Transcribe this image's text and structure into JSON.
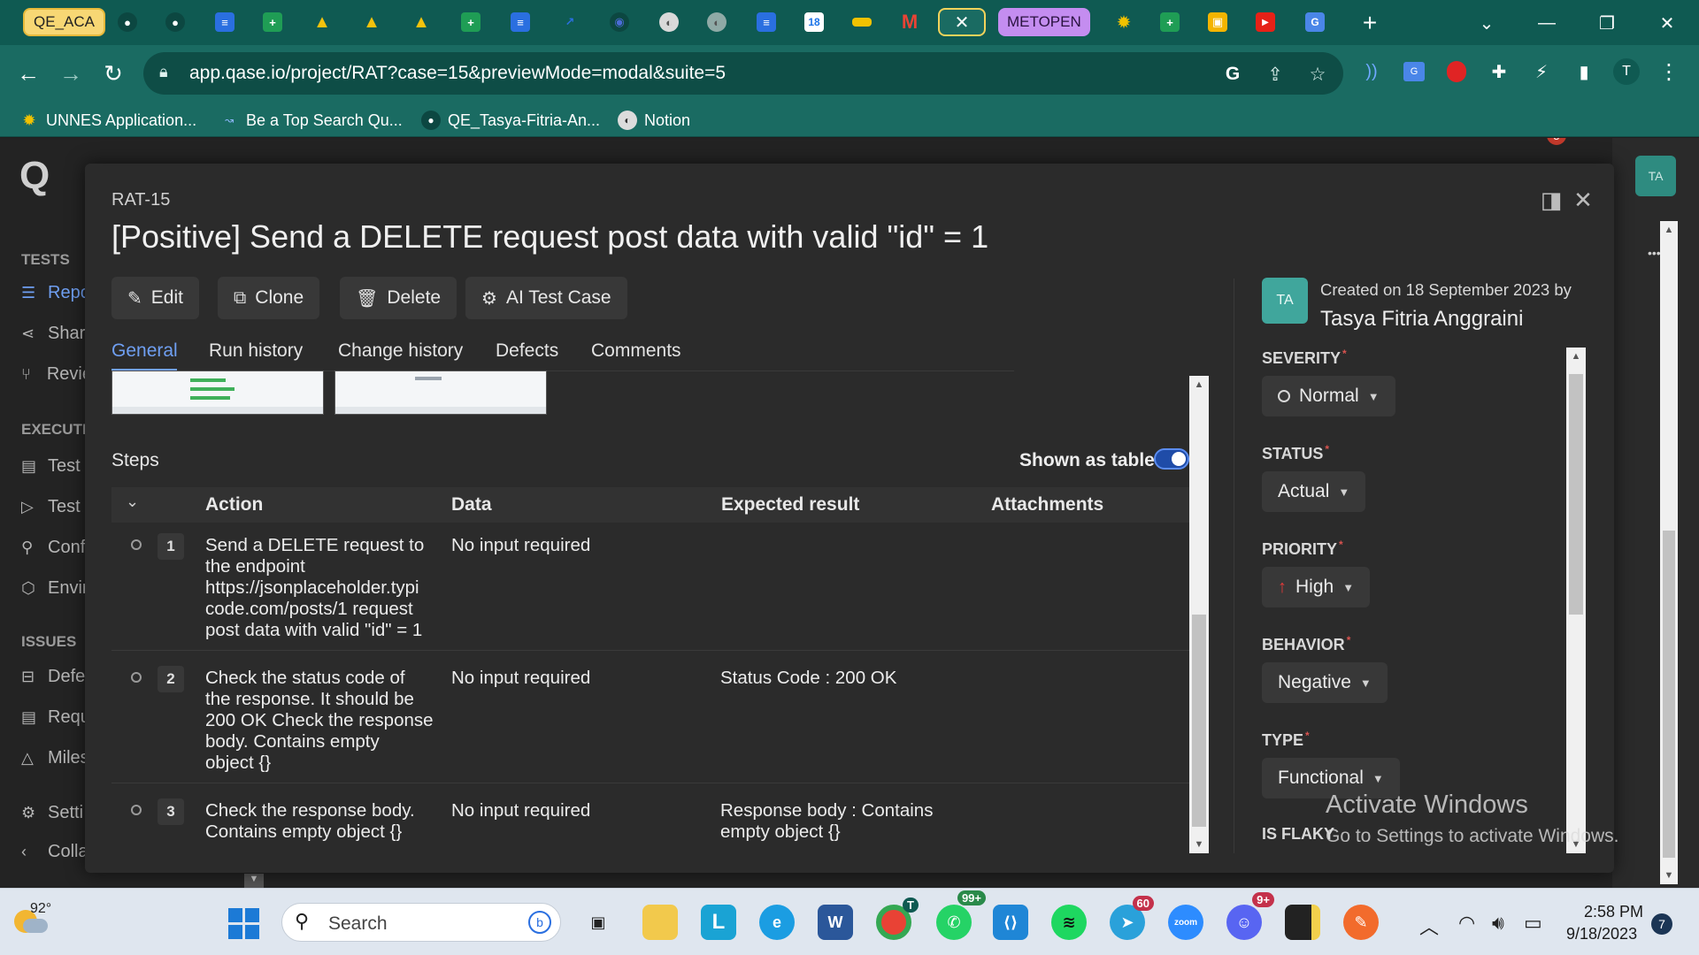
{
  "browser": {
    "tab_first_label": "QE_ACA",
    "tab_metopen_label": "METOPEN",
    "calendar_day": "18",
    "url": "app.qase.io/project/RAT?case=15&previewMode=modal&suite=5",
    "profile_initial": "T",
    "bookmarks": [
      {
        "label": "UNNES Application..."
      },
      {
        "label": "Be a Top Search Qu..."
      },
      {
        "label": "QE_Tasya-Fitria-An..."
      },
      {
        "label": "Notion"
      }
    ]
  },
  "app": {
    "logo": "Q",
    "notification_count": "5",
    "user_initials": "TA",
    "more_label": "•••",
    "sidebar": {
      "tests_heading": "TESTS",
      "execution_heading": "EXECUTI",
      "issues_heading": "ISSUES",
      "items": [
        {
          "label": "Repo"
        },
        {
          "label": "Shar"
        },
        {
          "label": "Revie"
        },
        {
          "label": "Test"
        },
        {
          "label": "Test"
        },
        {
          "label": "Conf"
        },
        {
          "label": "Envir"
        },
        {
          "label": "Defe"
        },
        {
          "label": "Requ"
        },
        {
          "label": "Miles"
        },
        {
          "label": "Setti"
        },
        {
          "label": "Colla"
        }
      ]
    }
  },
  "modal": {
    "case_code": "RAT-15",
    "title": "[Positive] Send a DELETE request post data with valid \"id\" = 1",
    "actions": [
      "Edit",
      "Clone",
      "Delete",
      "AI Test Case"
    ],
    "tabs": [
      "General",
      "Run history",
      "Change history",
      "Defects",
      "Comments"
    ],
    "steps_label": "Steps",
    "table_toggle_label": "Shown as table",
    "columns": [
      "Action",
      "Data",
      "Expected result",
      "Attachments"
    ],
    "steps": [
      {
        "num": "1",
        "action_lines": [
          "Send a DELETE request to",
          "the endpoint",
          "https://jsonplaceholder.typi",
          "code.com/posts/1 request",
          "post data with valid \"id\" = 1"
        ],
        "data": "No input required",
        "expected_lines": []
      },
      {
        "num": "2",
        "action_lines": [
          "Check the status code of",
          "the response. It should be",
          "200 OK Check the response",
          "body. Contains empty",
          "object {}"
        ],
        "data": "No input required",
        "expected_lines": [
          "Status Code : 200 OK"
        ]
      },
      {
        "num": "3",
        "action_lines": [
          "Check the response body.",
          "Contains empty object {}"
        ],
        "data": "No input required",
        "expected_lines": [
          "Response body : Contains",
          "empty object {}"
        ]
      }
    ],
    "sidebar": {
      "avatar_initials": "TA",
      "created_text": "Created on 18 September 2023 by",
      "author": "Tasya Fitria Anggraini",
      "properties": [
        {
          "label": "SEVERITY",
          "value": "Normal"
        },
        {
          "label": "STATUS",
          "value": "Actual"
        },
        {
          "label": "PRIORITY",
          "value": "High"
        },
        {
          "label": "BEHAVIOR",
          "value": "Negative"
        },
        {
          "label": "TYPE",
          "value": "Functional"
        }
      ],
      "is_flaky_label": "IS FLAKY"
    }
  },
  "watermark": {
    "title": "Activate Windows",
    "subtitle": "Go to Settings to activate Windows."
  },
  "taskbar": {
    "temperature": "92°",
    "search_placeholder": "Search",
    "whatsapp_badge": "99+",
    "telegram_badge": "60",
    "discord_badge": "9+",
    "chrome_badge": "T",
    "time": "2:58 PM",
    "date": "9/18/2023",
    "notification_count": "7"
  }
}
